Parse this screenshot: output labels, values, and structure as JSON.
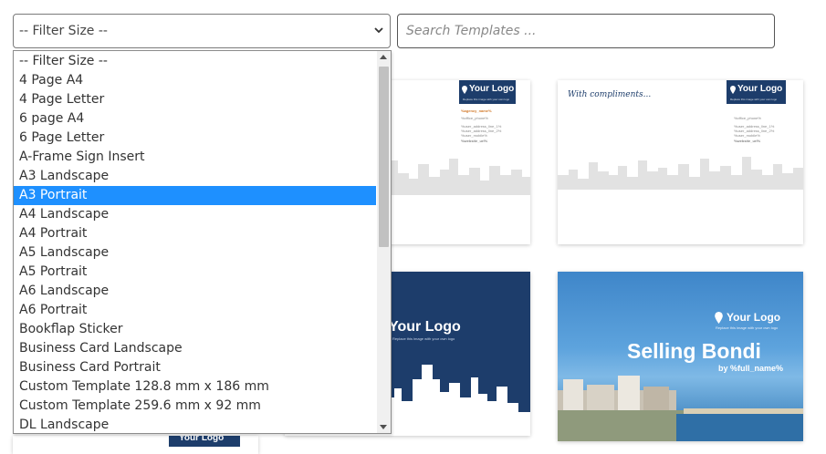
{
  "filter": {
    "selected_label": "-- Filter Size --",
    "options": [
      "-- Filter Size --",
      "4 Page A4",
      "4 Page Letter",
      "6 page A4",
      "6 Page Letter",
      "A-Frame Sign Insert",
      "A3 Landscape",
      "A3 Portrait",
      "A4 Landscape",
      "A4 Portrait",
      "A5 Landscape",
      "A5 Portrait",
      "A6 Landscape",
      "A6 Portrait",
      "Bookflap Sticker",
      "Business Card Landscape",
      "Business Card Portrait",
      "Custom Template 128.8 mm x 186 mm",
      "Custom Template 259.6 mm x 92 mm",
      "DL Landscape"
    ],
    "highlighted_option": "A3 Portrait"
  },
  "search": {
    "placeholder": "Search Templates ..."
  },
  "templates": {
    "letterhead": {
      "logo_text": "Your Logo",
      "logo_sub": "Replace this image with your own logo",
      "agency_name": "%agency_name%",
      "lines": [
        "%office_phone%",
        "%user_address_line_1%",
        "%user_address_line_2%",
        "%user_mobile%"
      ],
      "website": "%website_url%"
    },
    "compliments": {
      "greeting": "With compliments...",
      "logo_text": "Your Logo",
      "logo_sub": "Replace this image with your own logo",
      "lines": [
        "%office_phone%",
        "%user_address_line_1%",
        "%user_address_line_2%",
        "%user_mobile%"
      ],
      "website": "%website_url%"
    },
    "dark_card": {
      "logo_text": "Your Logo",
      "logo_sub": "Replace this image with your own logo"
    },
    "photo_card": {
      "logo_text": "Your Logo",
      "logo_sub": "Replace this image with your own logo",
      "title": "Selling Bondi",
      "subtitle": "by %full_name%"
    },
    "partial_card": {
      "logo_text": "Your Logo"
    }
  },
  "colors": {
    "brand_navy": "#1d3d6b",
    "selection_blue": "#1e90ff",
    "accent_orange": "#d27a2c",
    "skyline_gray": "#e2e2e2"
  },
  "icons": {
    "select_arrow": "chevron-down-icon",
    "logo_pin": "map-pin-icon"
  }
}
